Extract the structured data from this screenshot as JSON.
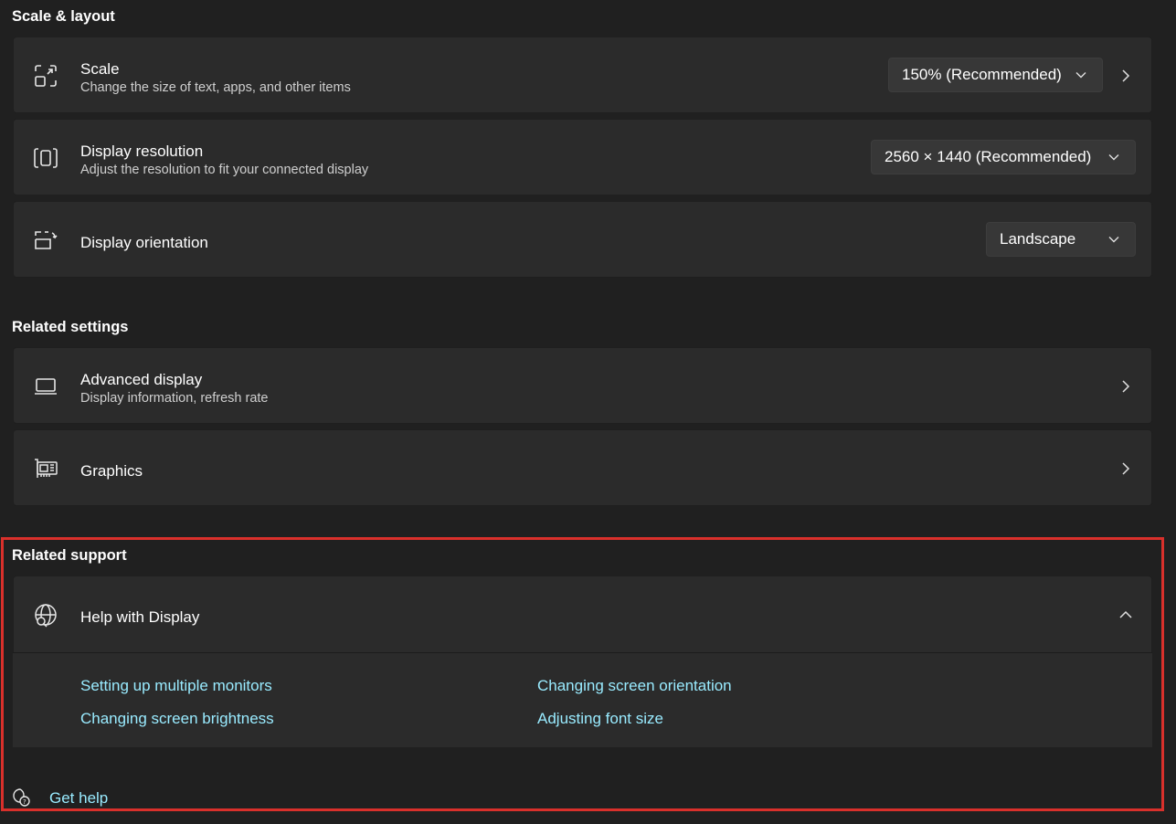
{
  "sections": {
    "scale_layout": "Scale & layout",
    "related_settings": "Related settings",
    "related_support": "Related support"
  },
  "scale": {
    "title": "Scale",
    "subtitle": "Change the size of text, apps, and other items",
    "value": "150% (Recommended)",
    "icon": "scale-icon"
  },
  "resolution": {
    "title": "Display resolution",
    "subtitle": "Adjust the resolution to fit your connected display",
    "value": "2560 × 1440 (Recommended)",
    "icon": "resolution-icon"
  },
  "orientation": {
    "title": "Display orientation",
    "value": "Landscape",
    "icon": "orientation-icon"
  },
  "advanced_display": {
    "title": "Advanced display",
    "subtitle": "Display information, refresh rate",
    "icon": "laptop-icon"
  },
  "graphics": {
    "title": "Graphics",
    "icon": "graphics-card-icon"
  },
  "help_display": {
    "title": "Help with Display",
    "icon": "globe-search-icon",
    "expanded": true,
    "links": [
      "Setting up multiple monitors",
      "Changing screen orientation",
      "Changing screen brightness",
      "Adjusting font size"
    ]
  },
  "get_help": {
    "label": "Get help",
    "icon": "help-chat-icon"
  },
  "colors": {
    "background": "#202020",
    "card": "#2b2b2b",
    "link": "#99ebff",
    "highlight": "#d9302b"
  }
}
